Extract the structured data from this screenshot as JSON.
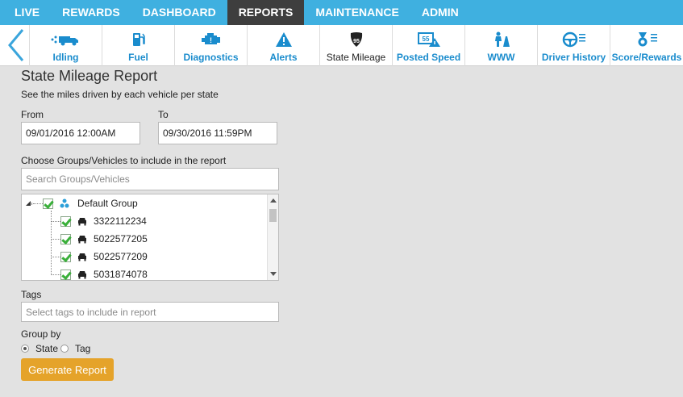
{
  "topnav": {
    "items": [
      {
        "label": "LIVE",
        "active": false
      },
      {
        "label": "REWARDS",
        "active": false
      },
      {
        "label": "DASHBOARD",
        "active": false
      },
      {
        "label": "REPORTS",
        "active": true
      },
      {
        "label": "MAINTENANCE",
        "active": false
      },
      {
        "label": "ADMIN",
        "active": false
      }
    ]
  },
  "subnav": {
    "items": [
      {
        "label": "Idling",
        "icon": "idling-truck-icon"
      },
      {
        "label": "Fuel",
        "icon": "fuel-pump-icon"
      },
      {
        "label": "Diagnostics",
        "icon": "engine-icon"
      },
      {
        "label": "Alerts",
        "icon": "warning-triangle-icon"
      },
      {
        "label": "State Mileage",
        "icon": "interstate-shield-icon",
        "shield_number": "95",
        "active": true
      },
      {
        "label": "Posted Speed",
        "icon": "speed-sign-icon",
        "sign_number": "55"
      },
      {
        "label": "WWW",
        "icon": "road-person-icon"
      },
      {
        "label": "Driver History",
        "icon": "steering-wheel-icon"
      },
      {
        "label": "Score/Rewards",
        "icon": "medal-icon"
      }
    ]
  },
  "report": {
    "title": "State Mileage Report",
    "subtitle": "See the miles driven by each vehicle per state",
    "from_label": "From",
    "from_value": "09/01/2016 12:00AM",
    "to_label": "To",
    "to_value": "09/30/2016 11:59PM",
    "groups_label": "Choose Groups/Vehicles to include in the report",
    "search_placeholder": "Search Groups/Vehicles",
    "tree": {
      "group": "Default Group",
      "vehicles": [
        "3322112234",
        "5022577205",
        "5022577209",
        "5031874078"
      ]
    },
    "tags_label": "Tags",
    "tags_placeholder": "Select tags to include in report",
    "group_by_label": "Group by",
    "group_by_options": [
      {
        "label": "State",
        "checked": true
      },
      {
        "label": "Tag",
        "checked": false
      }
    ],
    "generate_label": "Generate Report"
  },
  "colors": {
    "topnav_bg": "#3fb0e0",
    "topnav_active": "#3e3e3e",
    "link_blue": "#1a8ccd",
    "button_orange": "#e5a32a",
    "check_green": "#3ab03a",
    "page_bg": "#e2e2e2"
  }
}
